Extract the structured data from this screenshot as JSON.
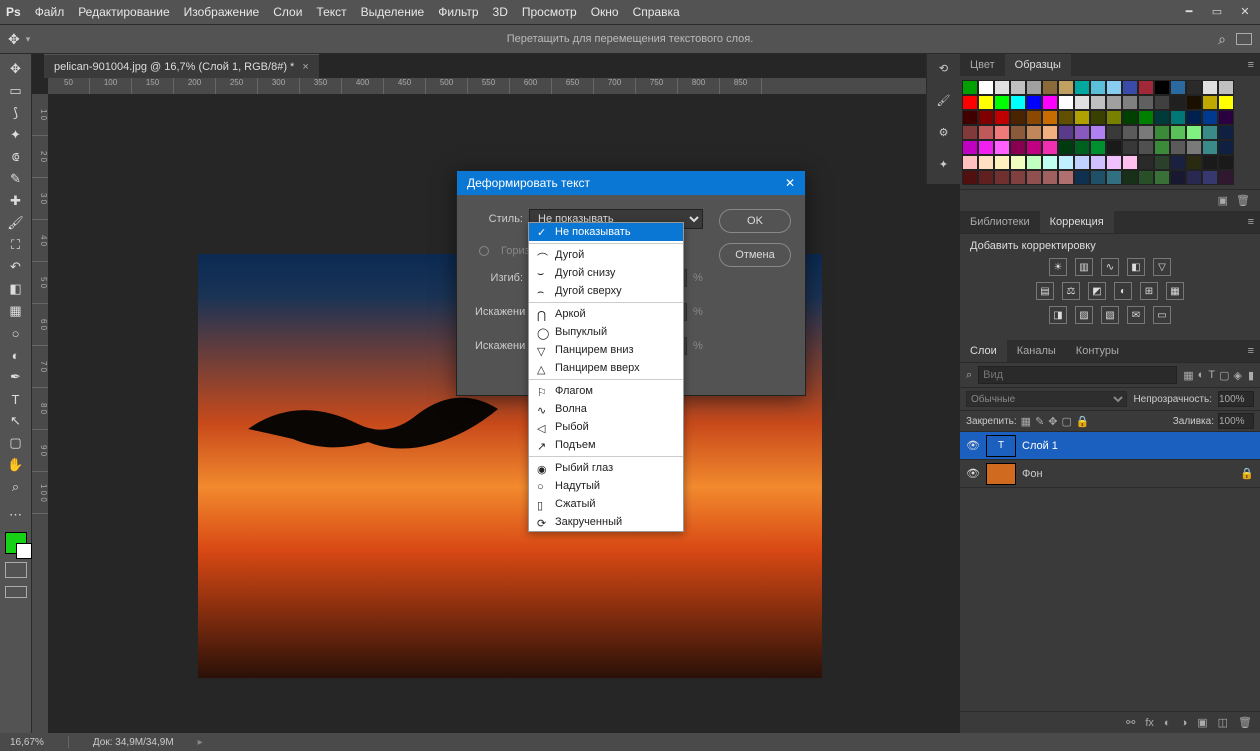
{
  "menubar": {
    "items": [
      "Файл",
      "Редактирование",
      "Изображение",
      "Слои",
      "Текст",
      "Выделение",
      "Фильтр",
      "3D",
      "Просмотр",
      "Окно",
      "Справка"
    ]
  },
  "optionsbar": {
    "hint": "Перетащить для перемещения текстового слоя."
  },
  "document": {
    "tab_title": "pelican-901004.jpg @ 16,7% (Слой 1, RGB/8#) *"
  },
  "dialog": {
    "title": "Деформировать текст",
    "style_label": "Стиль:",
    "style_value": "Не показывать",
    "orient_h": "Гориз",
    "bend_label": "Изгиб:",
    "distort1": "Искажени",
    "distort2": "Искажени",
    "ok": "OK",
    "cancel": "Отмена",
    "pct": "%",
    "dropdown": {
      "none": "Не показывать",
      "g1": [
        "Дугой",
        "Дугой снизу",
        "Дугой сверху"
      ],
      "g2": [
        "Аркой",
        "Выпуклый",
        "Панцирем вниз",
        "Панцирем вверх"
      ],
      "g3": [
        "Флагом",
        "Волна",
        "Рыбой",
        "Подъем"
      ],
      "g4": [
        "Рыбий глаз",
        "Надутый",
        "Сжатый",
        "Закрученный"
      ]
    }
  },
  "panels": {
    "color_tab": "Цвет",
    "swatches_tab": "Образцы",
    "libraries_tab": "Библиотеки",
    "corrections_tab": "Коррекция",
    "add_correction": "Добавить корректировку",
    "layers_tab": "Слои",
    "channels_tab": "Каналы",
    "paths_tab": "Контуры",
    "search_placeholder": "Вид",
    "blend_mode": "Обычные",
    "opacity_label": "Непрозрачность:",
    "opacity_value": "100%",
    "lock_label": "Закрепить:",
    "fill_label": "Заливка:",
    "fill_value": "100%",
    "layer1": "Слой 1",
    "layer_bg": "Фон"
  },
  "statusbar": {
    "zoom": "16,67%",
    "doc": "Док: 34,9M/34,9M"
  },
  "swatches": [
    "#00a000",
    "#ffffff",
    "#e0e0e0",
    "#c0c0c0",
    "#a0a0a0",
    "#8a6a3a",
    "#bfa060",
    "#00a8a0",
    "#5abfd8",
    "#88ccf0",
    "#3a4aa8",
    "#a02838",
    "#000000",
    "#2a6aa0",
    "#2a2a2a",
    "#e0e0e0",
    "#c0c0c0",
    "#ff0000",
    "#ffff00",
    "#00ff00",
    "#00ffff",
    "#0000ff",
    "#ff00ff",
    "#ffffff",
    "#e0e0e0",
    "#c0c0c0",
    "#a0a0a0",
    "#808080",
    "#606060",
    "#404040",
    "#202020",
    "#1a1000",
    "#bfa800",
    "#ffff00",
    "#400000",
    "#800000",
    "#c00000",
    "#4a2400",
    "#8a4800",
    "#c86c00",
    "#605000",
    "#b0a000",
    "#3a4000",
    "#788000",
    "#004000",
    "#008000",
    "#003a3a",
    "#007878",
    "#002050",
    "#003a90",
    "#2a0040",
    "#803a3a",
    "#c05a5a",
    "#f07a7a",
    "#8a5a3a",
    "#c0885a",
    "#f0b080",
    "#5a3a8a",
    "#885ac0",
    "#b080f0",
    "#3a3a3a",
    "#5a5a5a",
    "#7a7a7a",
    "#3a8a3a",
    "#5ac05a",
    "#80f080",
    "#3a8a8a",
    "#102040",
    "#c000c0",
    "#f020f0",
    "#ff60ff",
    "#8a0050",
    "#c00080",
    "#f030b0",
    "#003a10",
    "#006020",
    "#009030",
    "#1a1a1a",
    "#383838",
    "#505050",
    "#3a8a3a",
    "#5a5a5a",
    "#7a7a7a",
    "#3a8a8a",
    "#102040",
    "#ffc0c0",
    "#ffe0c0",
    "#fff0c0",
    "#f0ffc0",
    "#c0ffc0",
    "#c0fff0",
    "#c0f0ff",
    "#c0d0ff",
    "#d0c0ff",
    "#f0c0ff",
    "#ffc0f0",
    "#2a2a2a",
    "#2a402a",
    "#1a2040",
    "#2a2a10",
    "#1a1a1a",
    "#1a1a1a",
    "#501010",
    "#602020",
    "#703030",
    "#804040",
    "#905050",
    "#a06060",
    "#b07070",
    "#103050",
    "#205068",
    "#307080",
    "#183018",
    "#285028",
    "#387038",
    "#181830",
    "#282850",
    "#383870",
    "#301830"
  ]
}
